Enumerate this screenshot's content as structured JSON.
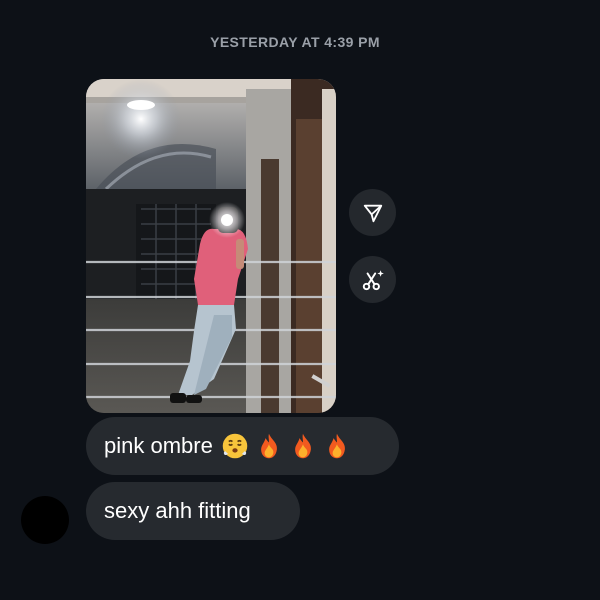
{
  "header": {
    "timestamp": "YESTERDAY AT 4:39 PM"
  },
  "message_photo": {
    "icon": "photo-message"
  },
  "actions": {
    "share_icon": "send-icon",
    "edit_icon": "scissors-sparkle-icon"
  },
  "messages": [
    {
      "text": "pink ombre",
      "emojis": [
        "huffing-face-emoji",
        "fire-emoji",
        "fire-emoji",
        "fire-emoji"
      ]
    },
    {
      "text": "sexy ahh fitting"
    }
  ],
  "sender": {
    "avatar_color": "#000000"
  },
  "colors": {
    "background": "#0d1117",
    "bubble": "#262a2f",
    "timestamp": "#9aa0a8",
    "action_button": "#24282d"
  }
}
